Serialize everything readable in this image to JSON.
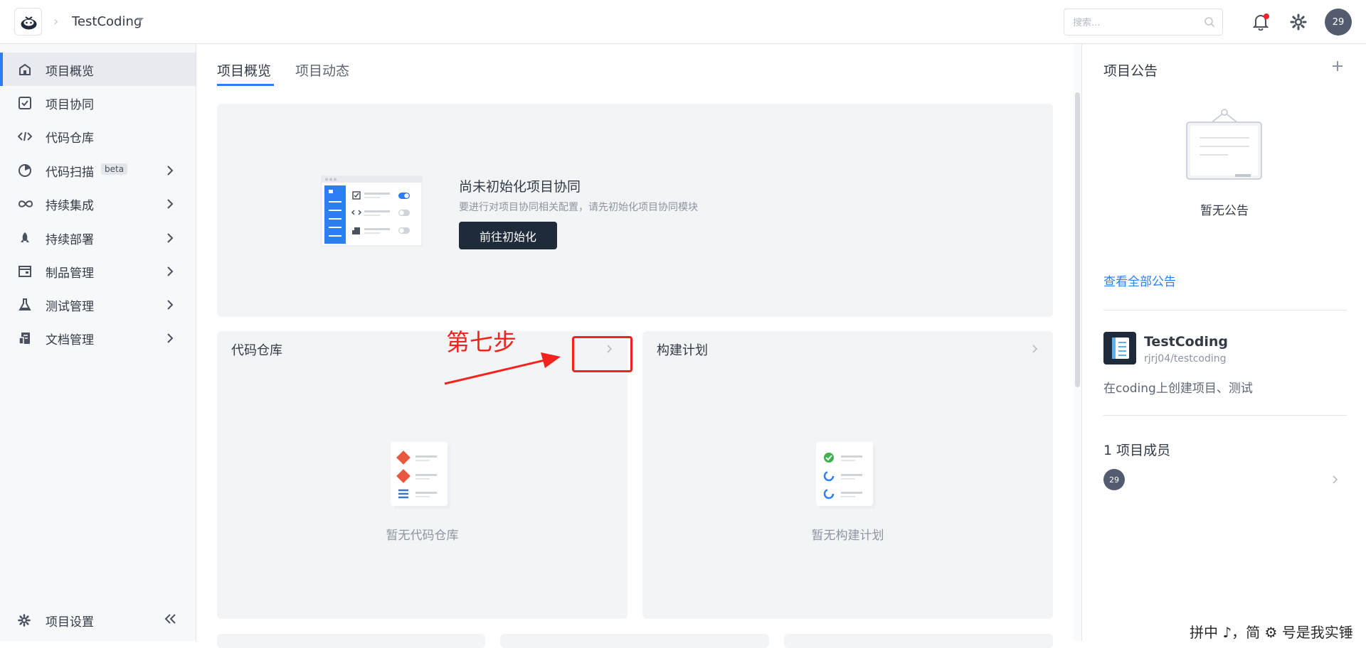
{
  "header": {
    "project_name": "TestCoding",
    "search_placeholder": "搜索...",
    "avatar_text": "29"
  },
  "sidebar": {
    "items": [
      {
        "label": "项目概览",
        "active": true,
        "has_chevron": false
      },
      {
        "label": "项目协同",
        "has_chevron": false
      },
      {
        "label": "代码仓库",
        "has_chevron": false
      },
      {
        "label": "代码扫描",
        "badge": "beta",
        "has_chevron": true
      },
      {
        "label": "持续集成",
        "has_chevron": true
      },
      {
        "label": "持续部署",
        "has_chevron": true
      },
      {
        "label": "制品管理",
        "has_chevron": true
      },
      {
        "label": "测试管理",
        "has_chevron": true
      },
      {
        "label": "文档管理",
        "has_chevron": true
      }
    ],
    "settings_label": "项目设置"
  },
  "tabs": [
    {
      "label": "项目概览",
      "active": true
    },
    {
      "label": "项目动态",
      "active": false
    }
  ],
  "init_card": {
    "title": "尚未初始化项目协同",
    "description": "要进行对项目协同相关配置，请先初始化项目协同模块",
    "button_label": "前往初始化"
  },
  "cards": [
    {
      "title": "代码仓库",
      "empty_text": "暂无代码仓库"
    },
    {
      "title": "构建计划",
      "empty_text": "暂无构建计划"
    }
  ],
  "announcements": {
    "title": "项目公告",
    "empty_text": "暂无公告",
    "view_all_label": "查看全部公告"
  },
  "project": {
    "name": "TestCoding",
    "path": "rjrj04/testcoding",
    "description": "在coding上创建项目、测试"
  },
  "members": {
    "title": "1 项目成员",
    "avatar_text": "29"
  },
  "annotation": {
    "text": "第七步"
  },
  "watermark": "拼中 ♪，简 ⚙ 号是我实锤",
  "colors": {
    "accent": "#2d7ef5",
    "dark_button": "#1f2a3a",
    "annotation": "#f2231d"
  }
}
